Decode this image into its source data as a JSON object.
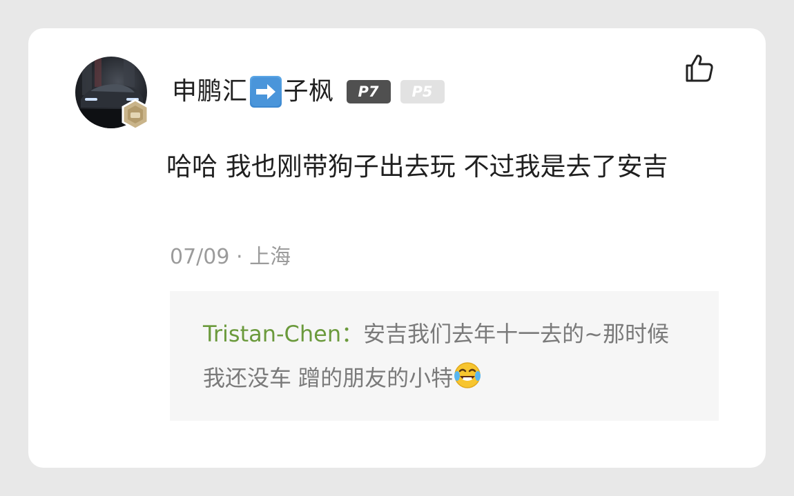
{
  "comment": {
    "username_prefix": "申鹏汇",
    "username_suffix": "子枫",
    "badges": [
      "P7",
      "P5"
    ],
    "text": "哈哈 我也刚带狗子出去玩 不过我是去了安吉",
    "date": "07/09",
    "separator": " · ",
    "location": "上海"
  },
  "reply": {
    "author": "Tristan-Chen：",
    "text": "安吉我们去年十一去的~那时候我还没车 蹭的朋友的小特"
  },
  "icons": {
    "like": "thumbs-up-icon",
    "arrow": "right-arrow-emoji",
    "laugh": "tears-of-joy-emoji"
  },
  "colors": {
    "reply_author": "#6b9a3c",
    "badge_p7": "#505050",
    "badge_p5": "#e2e2e2"
  }
}
